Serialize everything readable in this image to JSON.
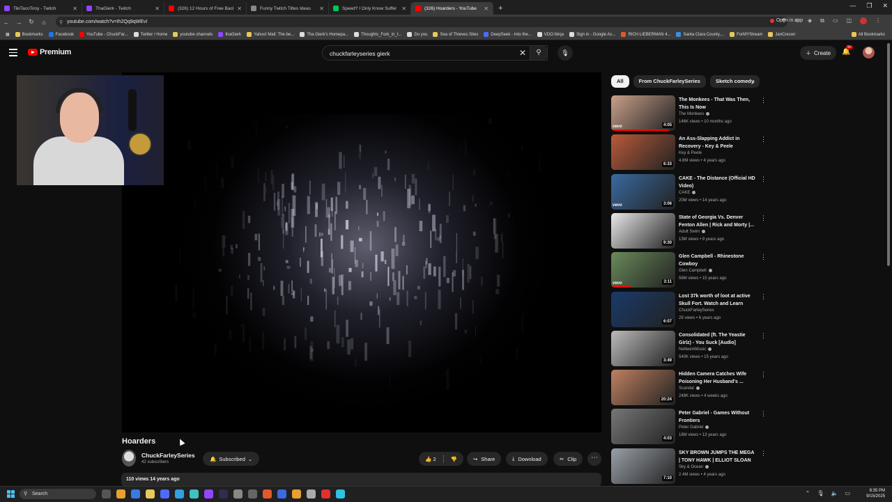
{
  "browser": {
    "tabs": [
      {
        "title": "TikiTacoTony - Twitch",
        "color": "#9146ff",
        "active": false
      },
      {
        "title": "ThaGierk - Twitch",
        "color": "#9146ff",
        "active": false
      },
      {
        "title": "(326) 12 Hours of Free Backgr",
        "color": "#ff0000",
        "active": false
      },
      {
        "title": "Funny Twitch Titles Ideas",
        "color": "#888888",
        "active": false
      },
      {
        "title": "Speed? I Only Know Suffer",
        "color": "#00c853",
        "active": false
      },
      {
        "title": "(326) Hoarders - YouTube",
        "color": "#ff0000",
        "active": true
      }
    ],
    "url": "youtube.com/watch?v=Ih2Qq9qWEvI",
    "open_in_app": "Open in app",
    "bookmarks": [
      {
        "label": "Bookmarks",
        "color": "#e8c85a"
      },
      {
        "label": "Facebook",
        "color": "#1877f2"
      },
      {
        "label": "YouTube - ChuckFar...",
        "color": "#ff0000"
      },
      {
        "label": "Twitter / Home",
        "color": "#dddddd"
      },
      {
        "label": "youtube channels",
        "color": "#e8c85a"
      },
      {
        "label": "thaGierk",
        "color": "#9146ff"
      },
      {
        "label": "Yahoo! Mail: The be...",
        "color": "#e8c85a"
      },
      {
        "label": "Tha Gierk's Homepa...",
        "color": "#dddddd"
      },
      {
        "label": "Thoughts_Fork_in_t...",
        "color": "#dddddd"
      },
      {
        "label": "Do you",
        "color": "#dddddd"
      },
      {
        "label": "Sea of Thieves Sites",
        "color": "#e8c85a"
      },
      {
        "label": "DeepSeek - Into the...",
        "color": "#4d6bfe"
      },
      {
        "label": "VDO.Ninja",
        "color": "#dddddd"
      },
      {
        "label": "Sign in - Google Ac...",
        "color": "#dddddd"
      },
      {
        "label": "RICH LIEBERMAN 4...",
        "color": "#e05a2a"
      },
      {
        "label": "Santa Clara County,...",
        "color": "#3a8ee6"
      },
      {
        "label": "ForMYStream",
        "color": "#e8c85a"
      },
      {
        "label": "JanCreson",
        "color": "#e8c85a"
      }
    ],
    "all_bookmarks": "All Bookmarks"
  },
  "youtube": {
    "logo_text": "Premium",
    "search_value": "chuckfarleyseries gierk",
    "create_label": "Create",
    "notif_count": "9+",
    "video": {
      "title": "Hoarders",
      "channel": "ChuckFarleySeries",
      "subscribers": "42 subscribers",
      "subscribed_label": "Subscribed",
      "likes": "2",
      "share_label": "Share",
      "download_label": "Download",
      "clip_label": "Clip",
      "views_date": "110 views  14 years ago"
    },
    "chips": [
      "All",
      "From ChuckFarleySeries",
      "Sketch comedy"
    ],
    "recommendations": [
      {
        "title": "The Monkees - That Was Then, This Is Now",
        "channel": "The Monkees",
        "meta": "146K views • 10 months ago",
        "duration": "4:05",
        "vevo": true,
        "verified": true,
        "thumb": "#c9a08a",
        "progress": 0.9
      },
      {
        "title": "An Ass-Slapping Addict in Recovery - Key & Peele",
        "channel": "Key & Peele",
        "meta": "4.8M views • 4 years ago",
        "duration": "6:33",
        "vevo": false,
        "verified": false,
        "thumb": "#b85a3a",
        "progress": 0.0
      },
      {
        "title": "CAKE - The Distance (Official HD Video)",
        "channel": "CAKE",
        "meta": "20M views • 14 years ago",
        "duration": "3:06",
        "vevo": true,
        "verified": true,
        "thumb": "#3a6aa0",
        "progress": 0.0
      },
      {
        "title": "State of Georgia Vs. Denver Fenton Allen | Rick and Morty |...",
        "channel": "Adult Swim",
        "meta": "13M views • 9 years ago",
        "duration": "9:30",
        "vevo": false,
        "verified": true,
        "thumb": "#e8e8e8",
        "progress": 0.0
      },
      {
        "title": "Glen Campbell - Rhinestone Cowboy",
        "channel": "Glen Campbell",
        "meta": "56M views • 15 years ago",
        "duration": "3:11",
        "vevo": true,
        "verified": true,
        "thumb": "#6a8a5a",
        "progress": 0.3
      },
      {
        "title": "Lost 37k worth of loot at active Skull Fort.  Watch and Learn",
        "channel": "ChuckFarleySeries",
        "meta": "29 views • 6 years ago",
        "duration": "6:07",
        "vevo": false,
        "verified": false,
        "thumb": "#1a3a6a",
        "progress": 0.0
      },
      {
        "title": "Consolidated (ft. The Yeastie Girlz) - You Suck [Audio]",
        "channel": "NettwerkMusic",
        "meta": "540K views • 15 years ago",
        "duration": "3:49",
        "vevo": false,
        "verified": true,
        "thumb": "#bbbbbb",
        "progress": 0.0
      },
      {
        "title": "Hidden Camera Catches Wife Poisoning Her Husband's ...",
        "channel": "Scandal",
        "meta": "248K views • 4 weeks ago",
        "duration": "20:24",
        "vevo": false,
        "verified": true,
        "thumb": "#c08060",
        "progress": 0.0
      },
      {
        "title": "Peter Gabriel - Games Without Frontiers",
        "channel": "Peter Gabriel",
        "meta": "18M views • 13 years ago",
        "duration": "4:03",
        "vevo": false,
        "verified": true,
        "thumb": "#777777",
        "progress": 0.0
      },
      {
        "title": "SKY BROWN JUMPS THE MEGA | TONY HAWK | ELLIOT SLOAN",
        "channel": "Sky & Ocean",
        "meta": "2.4M views • 4 years ago",
        "duration": "7:10",
        "vevo": false,
        "verified": true,
        "thumb": "#9aa0a8",
        "progress": 0.0
      }
    ]
  },
  "taskbar": {
    "search_label": "Search",
    "time": "8:35 PM",
    "date": "9/15/2025"
  }
}
